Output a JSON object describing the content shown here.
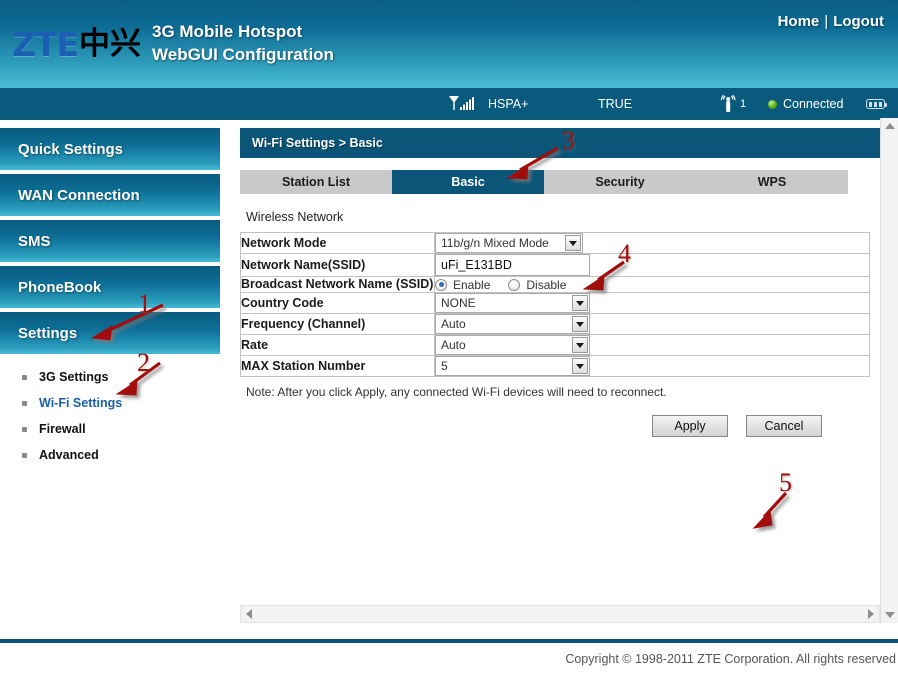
{
  "header": {
    "logo_text": "ZTE",
    "logo_cn": "中兴",
    "title_line1": "3G Mobile Hotspot",
    "title_line2": "WebGUI Configuration",
    "home_label": "Home",
    "separator": "|",
    "logout_label": "Logout"
  },
  "statusbar": {
    "signal_icon": "signal-bars-icon",
    "network_type": "HSPA+",
    "carrier": "TRUE",
    "wifi_icon": "wifi-broadcast-icon",
    "wifi_clients": "1",
    "connection_status": "Connected",
    "battery_icon": "battery-icon"
  },
  "sidebar": {
    "items": [
      {
        "label": "Quick Settings"
      },
      {
        "label": "WAN Connection"
      },
      {
        "label": "SMS"
      },
      {
        "label": "PhoneBook"
      },
      {
        "label": "Settings"
      }
    ],
    "subitems": [
      {
        "label": "3G Settings",
        "active": false
      },
      {
        "label": "Wi-Fi Settings",
        "active": true
      },
      {
        "label": "Firewall",
        "active": false
      },
      {
        "label": "Advanced",
        "active": false
      }
    ]
  },
  "main": {
    "breadcrumb": "Wi-Fi Settings > Basic",
    "tabs": [
      {
        "label": "Station List",
        "active": false
      },
      {
        "label": "Basic",
        "active": true
      },
      {
        "label": "Security",
        "active": false
      },
      {
        "label": "WPS",
        "active": false
      }
    ],
    "section_title": "Wireless Network",
    "rows": [
      {
        "label": "Network Mode",
        "type": "select",
        "value": "11b/g/n Mixed Mode"
      },
      {
        "label": "Network Name(SSID)",
        "type": "text",
        "value": "uFi_E131BD"
      },
      {
        "label": "Broadcast Network Name (SSID)",
        "type": "radio",
        "option_on": "Enable",
        "option_off": "Disable",
        "selected": "Enable"
      },
      {
        "label": "Country Code",
        "type": "select",
        "value": "NONE"
      },
      {
        "label": "Frequency (Channel)",
        "type": "select",
        "value": "Auto"
      },
      {
        "label": "Rate",
        "type": "select",
        "value": "Auto"
      },
      {
        "label": "MAX Station Number",
        "type": "select",
        "value": "5"
      }
    ],
    "note": "Note: After you click Apply, any connected Wi-Fi devices will need to reconnect.",
    "apply_label": "Apply",
    "cancel_label": "Cancel"
  },
  "footer": {
    "copyright": "Copyright © 1998-2011 ZTE Corporation. All rights reserved"
  },
  "annotations": [
    {
      "number": "1",
      "target": "sidebar-item-settings"
    },
    {
      "number": "2",
      "target": "sidebar-subitem-wifi-settings"
    },
    {
      "number": "3",
      "target": "tab-basic"
    },
    {
      "number": "4",
      "target": "ssid-input"
    },
    {
      "number": "5",
      "target": "apply-button"
    }
  ],
  "colors": {
    "brand_dark": "#0a5578",
    "brand_light": "#47bcd6",
    "annotation_red": "#a10f0f",
    "link_blue": "#1a5fa8"
  }
}
